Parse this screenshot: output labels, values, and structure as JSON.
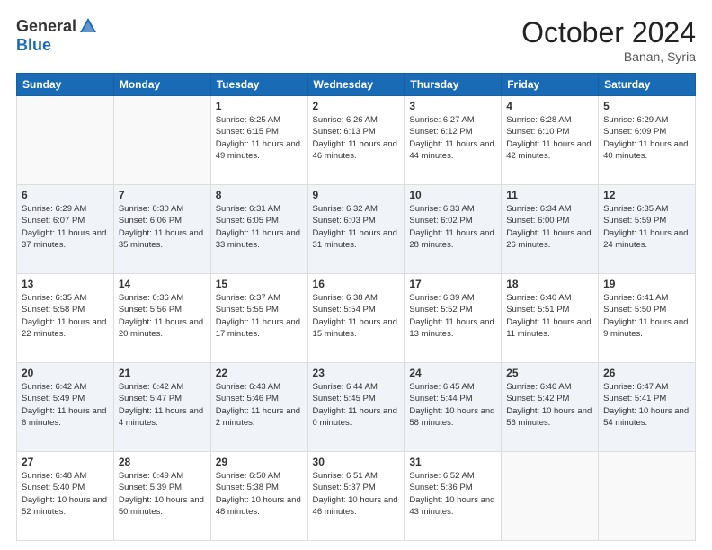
{
  "header": {
    "logo_general": "General",
    "logo_blue": "Blue",
    "month_title": "October 2024",
    "location": "Banan, Syria"
  },
  "weekdays": [
    "Sunday",
    "Monday",
    "Tuesday",
    "Wednesday",
    "Thursday",
    "Friday",
    "Saturday"
  ],
  "weeks": [
    [
      {
        "day": "",
        "info": ""
      },
      {
        "day": "",
        "info": ""
      },
      {
        "day": "1",
        "info": "Sunrise: 6:25 AM\nSunset: 6:15 PM\nDaylight: 11 hours and 49 minutes."
      },
      {
        "day": "2",
        "info": "Sunrise: 6:26 AM\nSunset: 6:13 PM\nDaylight: 11 hours and 46 minutes."
      },
      {
        "day": "3",
        "info": "Sunrise: 6:27 AM\nSunset: 6:12 PM\nDaylight: 11 hours and 44 minutes."
      },
      {
        "day": "4",
        "info": "Sunrise: 6:28 AM\nSunset: 6:10 PM\nDaylight: 11 hours and 42 minutes."
      },
      {
        "day": "5",
        "info": "Sunrise: 6:29 AM\nSunset: 6:09 PM\nDaylight: 11 hours and 40 minutes."
      }
    ],
    [
      {
        "day": "6",
        "info": "Sunrise: 6:29 AM\nSunset: 6:07 PM\nDaylight: 11 hours and 37 minutes."
      },
      {
        "day": "7",
        "info": "Sunrise: 6:30 AM\nSunset: 6:06 PM\nDaylight: 11 hours and 35 minutes."
      },
      {
        "day": "8",
        "info": "Sunrise: 6:31 AM\nSunset: 6:05 PM\nDaylight: 11 hours and 33 minutes."
      },
      {
        "day": "9",
        "info": "Sunrise: 6:32 AM\nSunset: 6:03 PM\nDaylight: 11 hours and 31 minutes."
      },
      {
        "day": "10",
        "info": "Sunrise: 6:33 AM\nSunset: 6:02 PM\nDaylight: 11 hours and 28 minutes."
      },
      {
        "day": "11",
        "info": "Sunrise: 6:34 AM\nSunset: 6:00 PM\nDaylight: 11 hours and 26 minutes."
      },
      {
        "day": "12",
        "info": "Sunrise: 6:35 AM\nSunset: 5:59 PM\nDaylight: 11 hours and 24 minutes."
      }
    ],
    [
      {
        "day": "13",
        "info": "Sunrise: 6:35 AM\nSunset: 5:58 PM\nDaylight: 11 hours and 22 minutes."
      },
      {
        "day": "14",
        "info": "Sunrise: 6:36 AM\nSunset: 5:56 PM\nDaylight: 11 hours and 20 minutes."
      },
      {
        "day": "15",
        "info": "Sunrise: 6:37 AM\nSunset: 5:55 PM\nDaylight: 11 hours and 17 minutes."
      },
      {
        "day": "16",
        "info": "Sunrise: 6:38 AM\nSunset: 5:54 PM\nDaylight: 11 hours and 15 minutes."
      },
      {
        "day": "17",
        "info": "Sunrise: 6:39 AM\nSunset: 5:52 PM\nDaylight: 11 hours and 13 minutes."
      },
      {
        "day": "18",
        "info": "Sunrise: 6:40 AM\nSunset: 5:51 PM\nDaylight: 11 hours and 11 minutes."
      },
      {
        "day": "19",
        "info": "Sunrise: 6:41 AM\nSunset: 5:50 PM\nDaylight: 11 hours and 9 minutes."
      }
    ],
    [
      {
        "day": "20",
        "info": "Sunrise: 6:42 AM\nSunset: 5:49 PM\nDaylight: 11 hours and 6 minutes."
      },
      {
        "day": "21",
        "info": "Sunrise: 6:42 AM\nSunset: 5:47 PM\nDaylight: 11 hours and 4 minutes."
      },
      {
        "day": "22",
        "info": "Sunrise: 6:43 AM\nSunset: 5:46 PM\nDaylight: 11 hours and 2 minutes."
      },
      {
        "day": "23",
        "info": "Sunrise: 6:44 AM\nSunset: 5:45 PM\nDaylight: 11 hours and 0 minutes."
      },
      {
        "day": "24",
        "info": "Sunrise: 6:45 AM\nSunset: 5:44 PM\nDaylight: 10 hours and 58 minutes."
      },
      {
        "day": "25",
        "info": "Sunrise: 6:46 AM\nSunset: 5:42 PM\nDaylight: 10 hours and 56 minutes."
      },
      {
        "day": "26",
        "info": "Sunrise: 6:47 AM\nSunset: 5:41 PM\nDaylight: 10 hours and 54 minutes."
      }
    ],
    [
      {
        "day": "27",
        "info": "Sunrise: 6:48 AM\nSunset: 5:40 PM\nDaylight: 10 hours and 52 minutes."
      },
      {
        "day": "28",
        "info": "Sunrise: 6:49 AM\nSunset: 5:39 PM\nDaylight: 10 hours and 50 minutes."
      },
      {
        "day": "29",
        "info": "Sunrise: 6:50 AM\nSunset: 5:38 PM\nDaylight: 10 hours and 48 minutes."
      },
      {
        "day": "30",
        "info": "Sunrise: 6:51 AM\nSunset: 5:37 PM\nDaylight: 10 hours and 46 minutes."
      },
      {
        "day": "31",
        "info": "Sunrise: 6:52 AM\nSunset: 5:36 PM\nDaylight: 10 hours and 43 minutes."
      },
      {
        "day": "",
        "info": ""
      },
      {
        "day": "",
        "info": ""
      }
    ]
  ]
}
